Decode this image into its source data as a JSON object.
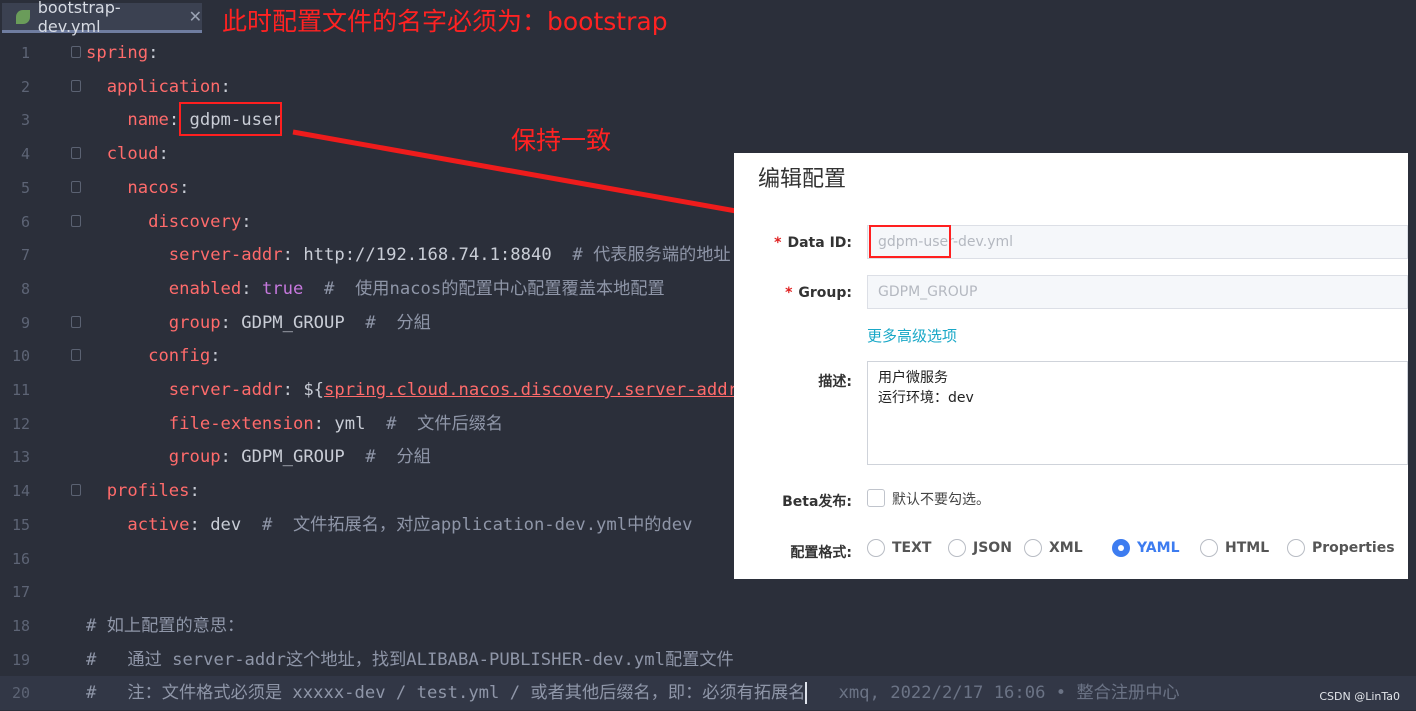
{
  "tab": {
    "filename": "bootstrap-dev.yml",
    "close": "✕"
  },
  "annotations": {
    "title_note": "此时配置文件的名字必须为：bootstrap",
    "arrow_note": "保持一致"
  },
  "code_lines": [
    {
      "n": "1",
      "html": "<span class='k'>spring</span>:"
    },
    {
      "n": "2",
      "html": "  <span class='k'>application</span>:"
    },
    {
      "n": "3",
      "html": "    <span class='k'>name</span>: gdpm-user"
    },
    {
      "n": "4",
      "html": "  <span class='k'>cloud</span>:"
    },
    {
      "n": "5",
      "html": "    <span class='k'>nacos</span>:"
    },
    {
      "n": "6",
      "html": "      <span class='k'>discovery</span>:"
    },
    {
      "n": "7",
      "html": "        <span class='k'>server-addr</span>: http://192.168.74.1:8840  <span class='c'># 代表服务端的地址</span>"
    },
    {
      "n": "8",
      "html": "        <span class='k'>enabled</span>: <span class='t'>true</span>  <span class='c'>#  使用nacos的配置中心配置覆盖本地配置</span>"
    },
    {
      "n": "9",
      "html": "        <span class='k'>group</span>: GDPM_GROUP  <span class='c'>#  分組</span>"
    },
    {
      "n": "10",
      "html": "      <span class='k'>config</span>:"
    },
    {
      "n": "11",
      "html": "        <span class='k'>server-addr</span>: ${<span class='u'>spring.cloud.nacos.discovery.server-addr</span>}"
    },
    {
      "n": "12",
      "html": "        <span class='k'>file-extension</span>: yml  <span class='c'>#  文件后缀名</span>"
    },
    {
      "n": "13",
      "html": "        <span class='k'>group</span>: GDPM_GROUP  <span class='c'>#  分組</span>"
    },
    {
      "n": "14",
      "html": "  <span class='k'>profiles</span>:"
    },
    {
      "n": "15",
      "html": "    <span class='k'>active</span>: dev  <span class='c'>#  文件拓展名，对应application-dev.yml中的dev</span>"
    },
    {
      "n": "16",
      "html": ""
    },
    {
      "n": "17",
      "html": ""
    },
    {
      "n": "18",
      "html": "<span class='c'># 如上配置的意思：</span>"
    },
    {
      "n": "19",
      "html": "<span class='c'>#   通过 server-addr这个地址，找到ALIBABA-PUBLISHER-dev.yml配置文件</span>"
    },
    {
      "n": "20",
      "html": "<span class='c'>#   注：文件格式必须是 xxxxx-dev / test.yml / 或者其他后缀名，即：必须有拓展名</span><span class='caret'></span>   <span class='blame'>xmq, 2022/2/17 16:06 • 整合注册中心</span>"
    }
  ],
  "panel": {
    "title": "编辑配置",
    "data_id_label": "Data ID:",
    "data_id_value": "gdpm-user-dev.yml",
    "group_label": "Group:",
    "group_value": "GDPM_GROUP",
    "advanced_link": "更多高级选项",
    "desc_label": "描述:",
    "desc_line1": "用户微服务",
    "desc_line2": "运行环境：dev",
    "beta_label": "Beta发布:",
    "beta_text": "默认不要勾选。",
    "format_label": "配置格式:",
    "formats": [
      "TEXT",
      "JSON",
      "XML",
      "YAML",
      "HTML",
      "Properties"
    ],
    "selected_format": "YAML"
  },
  "watermark": "CSDN @LinTa0",
  "colors": {
    "editor_bg": "#2b2f3a",
    "key": "#ff6b6b",
    "annotation": "#ff2222",
    "accent": "#3d7cf0"
  }
}
